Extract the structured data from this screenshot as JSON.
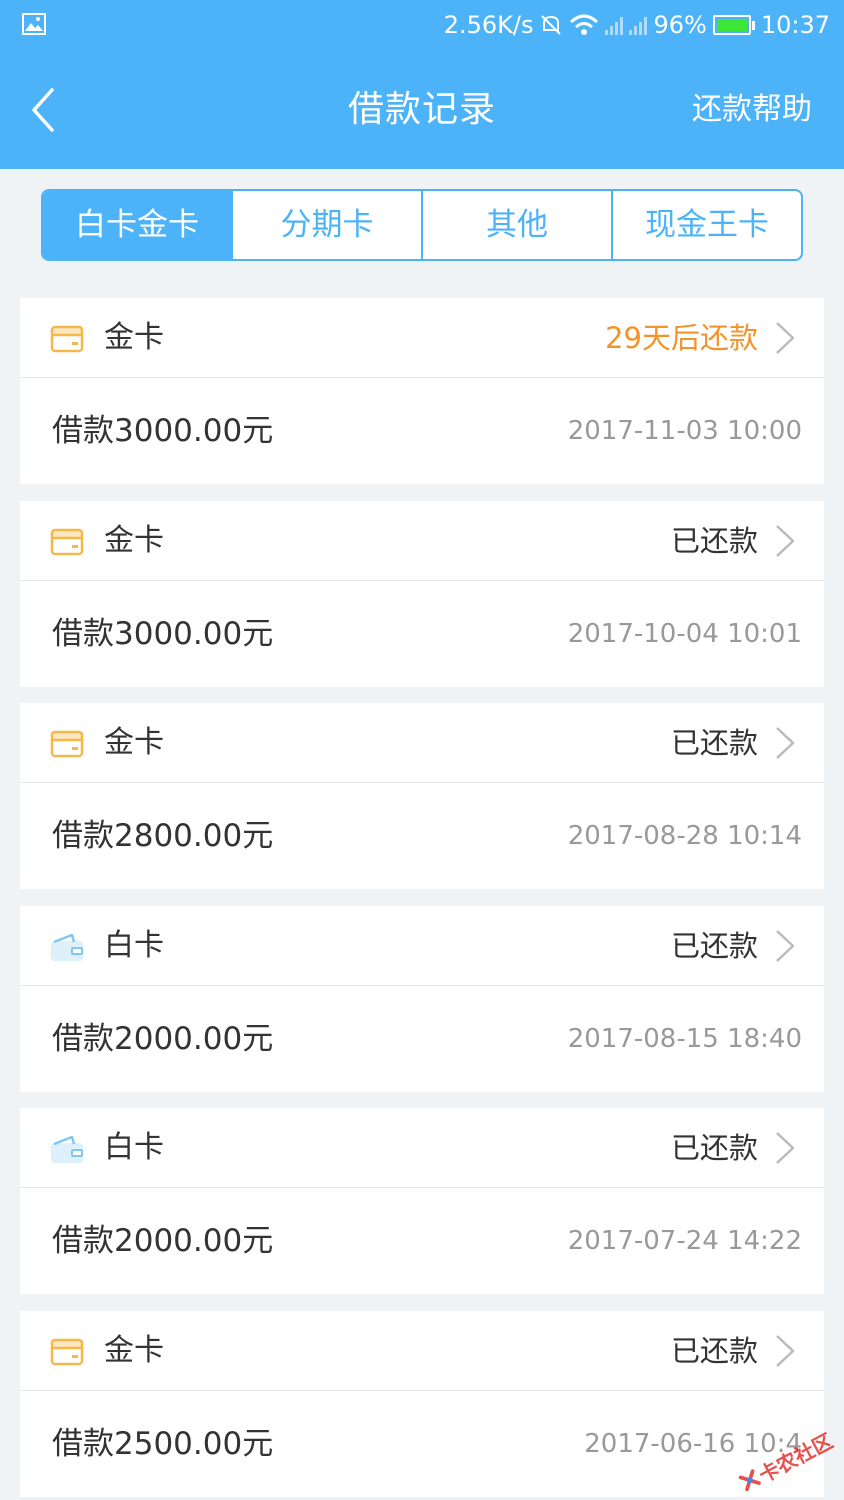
{
  "status_bar": {
    "speed": "2.56K/s",
    "battery": "96%",
    "time": "10:37",
    "icons": [
      "gallery-icon",
      "mute-icon",
      "wifi-icon",
      "signal-icon",
      "battery-icon"
    ]
  },
  "header": {
    "title": "借款记录",
    "help": "还款帮助"
  },
  "tabs": [
    {
      "label": "白卡金卡",
      "active": true
    },
    {
      "label": "分期卡",
      "active": false
    },
    {
      "label": "其他",
      "active": false
    },
    {
      "label": "现金王卡",
      "active": false
    }
  ],
  "records": [
    {
      "card_type": "金卡",
      "icon": "gold-card-icon",
      "status": "29天后还款",
      "status_kind": "due",
      "amount": "借款3000.00元",
      "date": "2017-11-03 10:00"
    },
    {
      "card_type": "金卡",
      "icon": "gold-card-icon",
      "status": "已还款",
      "status_kind": "repaid",
      "amount": "借款3000.00元",
      "date": "2017-10-04 10:01"
    },
    {
      "card_type": "金卡",
      "icon": "gold-card-icon",
      "status": "已还款",
      "status_kind": "repaid",
      "amount": "借款2800.00元",
      "date": "2017-08-28 10:14"
    },
    {
      "card_type": "白卡",
      "icon": "wallet-icon",
      "status": "已还款",
      "status_kind": "repaid",
      "amount": "借款2000.00元",
      "date": "2017-08-15 18:40"
    },
    {
      "card_type": "白卡",
      "icon": "wallet-icon",
      "status": "已还款",
      "status_kind": "repaid",
      "amount": "借款2000.00元",
      "date": "2017-07-24 14:22"
    },
    {
      "card_type": "金卡",
      "icon": "gold-card-icon",
      "status": "已还款",
      "status_kind": "repaid",
      "amount": "借款2500.00元",
      "date": "2017-06-16 10:4"
    }
  ],
  "watermark": {
    "text": "卡农社区"
  },
  "colors": {
    "primary": "#4db3f9",
    "due": "#f2942b",
    "gold_icon": "#f5b94a",
    "wallet_icon": "#7fc8f3",
    "text": "#333333",
    "muted": "#999999",
    "background": "#eff3f6"
  }
}
